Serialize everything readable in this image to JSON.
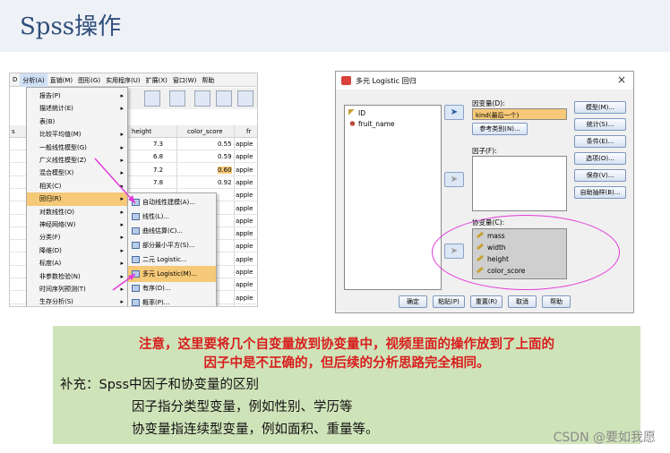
{
  "slide": {
    "title": "Spss操作"
  },
  "left": {
    "menubar": [
      "D",
      "分析(A)",
      "直销(M)",
      "图形(G)",
      "实用程序(U)",
      "扩展(X)",
      "窗口(W)",
      "帮助"
    ],
    "grid_headers": [
      "s",
      "height",
      "color_score",
      "fr"
    ],
    "rows": [
      {
        "height": "7.3",
        "color": "0.55",
        "fruit": "apple"
      },
      {
        "height": "6.8",
        "color": "0.59",
        "fruit": "apple"
      },
      {
        "height": "7.2",
        "color": "0.60",
        "fruit": "apple"
      },
      {
        "height": "7.8",
        "color": "0.92",
        "fruit": "apple"
      },
      {
        "height": "",
        "color": "",
        "fruit": "apple"
      },
      {
        "height": "",
        "color": "",
        "fruit": "apple"
      },
      {
        "height": "",
        "color": "",
        "fruit": "apple"
      },
      {
        "height": "",
        "color": "",
        "fruit": "apple"
      },
      {
        "height": "",
        "color": "",
        "fruit": "apple"
      },
      {
        "height": "",
        "color": "",
        "fruit": "apple"
      },
      {
        "height": "",
        "color": "",
        "fruit": "apple"
      },
      {
        "height": "",
        "color": "",
        "fruit": "apple"
      },
      {
        "height": "",
        "color": "",
        "fruit": "apple"
      }
    ],
    "analysis_menu": [
      "报告(P)",
      "描述统计(E)",
      "表(B)",
      "比较平均值(M)",
      "一般线性模型(G)",
      "广义线性模型(Z)",
      "混合模型(X)",
      "相关(C)",
      "回归(R)",
      "对数线性(O)",
      "神经网络(W)",
      "分类(F)",
      "降维(D)",
      "标度(A)",
      "非参数检验(N)",
      "时间序列预测(T)",
      "生存分析(S)"
    ],
    "regression_menu": [
      "自动线性建模(A)...",
      "线性(L)...",
      "曲线估算(C)...",
      "部分最小平方(S)...",
      "二元 Logistic...",
      "多元 Logistic(M)...",
      "有序(D)...",
      "概率(P)..."
    ]
  },
  "dialog": {
    "title": "多元 Logistic 回归",
    "close": "×",
    "variables": [
      "ID",
      "fruit_name"
    ],
    "dependent_label": "因变量(D):",
    "dependent_value": "kind(最后一个)",
    "reference_btn": "参考类别(N)...",
    "factor_label": "因子(F):",
    "covariate_label": "协变量(C):",
    "covariates": [
      "mass",
      "width",
      "height",
      "color_score"
    ],
    "side_buttons": [
      "模型(M)...",
      "统计(S)...",
      "条件(E)...",
      "选项(O)...",
      "保存(V)...",
      "自助抽样(B)..."
    ],
    "bottom_buttons": [
      "确定",
      "粘贴(P)",
      "重置(R)",
      "取消",
      "帮助"
    ]
  },
  "note": {
    "red_line1": "注意，这里要将几个自变量放到协变量中，视频里面的操作放到了上面的",
    "red_line2": "因子中是不正确的，但后续的分析思路完全相同。",
    "supplement": "补充：Spss中因子和协变量的区别",
    "factor_def": "因子指分类型变量，例如性别、学历等",
    "covariate_def": "协变量指连续型变量，例如面积、重量等。"
  },
  "watermark": "CSDN @要如我愿",
  "colors": {
    "highlight": "#f5c978",
    "annotation": "#e23ad9",
    "note_bg": "#cfe3b9",
    "note_red": "#d81e1e"
  }
}
